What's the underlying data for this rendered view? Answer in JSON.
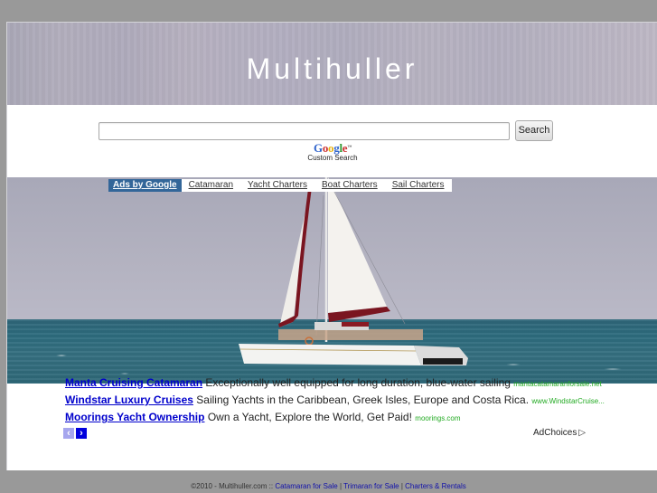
{
  "header": {
    "title": "Multihuller"
  },
  "search": {
    "input_value": "",
    "placeholder": "",
    "button_label": "Search",
    "branding": {
      "logo_letters": [
        "G",
        "o",
        "o",
        "g",
        "l",
        "e"
      ],
      "trademark": "™",
      "label": "Custom Search"
    }
  },
  "link_units": {
    "label": "Ads by Google",
    "links": [
      "Catamaran",
      "Yacht Charters",
      "Boat Charters",
      "Sail Charters"
    ]
  },
  "ads": [
    {
      "title": "Manta Cruising Catamaran",
      "text": "Exceptionally well equipped for long duration, blue-water sailing",
      "url": "mantacatamaranforsale.net"
    },
    {
      "title": "Windstar Luxury Cruises",
      "text": "Sailing Yachts in the Caribbean, Greek Isles, Europe and Costa Rica.",
      "url": "www.WindstarCruise..."
    },
    {
      "title": "Moorings Yacht Ownership",
      "text": "Own a Yacht, Explore the World, Get Paid!",
      "url": "moorings.com"
    }
  ],
  "ad_nav": {
    "prev": "‹",
    "next": "›"
  },
  "adchoices": {
    "label": "AdChoices",
    "icon": "▷"
  },
  "footer": {
    "copyright": "©2010 - Multihuller.com ::",
    "links": [
      "Catamaran for Sale",
      "Trimaran for Sale",
      "Charters & Rentals"
    ],
    "separator": "|"
  },
  "colors": {
    "page_bg": "#999999",
    "ads_by_google_bg": "#336699",
    "ad_title": "#0000cc",
    "ad_url": "#22aa22",
    "nav_next": "#0000dd",
    "nav_prev": "#a6a6ee"
  }
}
